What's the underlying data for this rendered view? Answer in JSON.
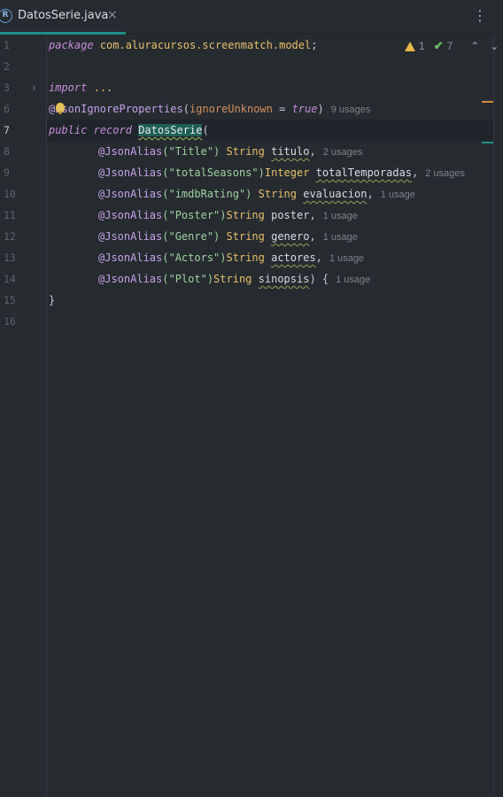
{
  "tab": {
    "icon_glyph": "R",
    "title": "DatosSerie.java",
    "close_glyph": "×"
  },
  "toolbar": {
    "more_glyph": "⋮"
  },
  "inspections": {
    "warnings": "1",
    "checks": "7",
    "check_glyph": "✔",
    "up_glyph": "⌃",
    "down_glyph": "⌄"
  },
  "lines": {
    "l1": {
      "num": "1",
      "kw": "package",
      "pkg": "com.aluracursos.screenmatch.model",
      "end": ";"
    },
    "l2": {
      "num": "2"
    },
    "l3": {
      "num": "3",
      "fold": "›",
      "kw": "import",
      "rest": "..."
    },
    "l6": {
      "num": "6",
      "ann": "@JsonIgnoreProperties",
      "open": "(",
      "param": "ignoreUnknown",
      "eq": " = ",
      "val": "true",
      "close": ")",
      "usages": "9 usages"
    },
    "l7": {
      "num": "7",
      "kw1": "public",
      "kw2": "record",
      "name": "DatosSerie",
      "open": "("
    },
    "l8": {
      "num": "8",
      "ann": "@JsonAlias",
      "arg": "(\"Title\")",
      "type": "String",
      "ident": "titulo",
      "end": ",",
      "usages": "2 usages"
    },
    "l9": {
      "num": "9",
      "ann": "@JsonAlias",
      "arg": "(\"totalSeasons\")",
      "type": "Integer",
      "ident": "totalTemporadas",
      "end": ",",
      "usages": "2 usages"
    },
    "l10": {
      "num": "10",
      "ann": "@JsonAlias",
      "arg": "(\"imdbRating\")",
      "type": "String",
      "ident": "evaluacion",
      "end": ",",
      "usages": "1 usage"
    },
    "l11": {
      "num": "11",
      "ann": "@JsonAlias",
      "arg": "(\"Poster\")",
      "type": "String",
      "ident": "poster",
      "end": ",",
      "usages": "1 usage"
    },
    "l12": {
      "num": "12",
      "ann": "@JsonAlias",
      "arg": "(\"Genre\")",
      "type": "String",
      "ident": "genero",
      "end": ",",
      "usages": "1 usage"
    },
    "l13": {
      "num": "13",
      "ann": "@JsonAlias",
      "arg": "(\"Actors\")",
      "type": "String",
      "ident": "actores",
      "end": ",",
      "usages": "1 usage"
    },
    "l14": {
      "num": "14",
      "ann": "@JsonAlias",
      "arg": "(\"Plot\")",
      "type": "String",
      "ident": "sinopsis",
      "end": ") {",
      "usages": "1 usage"
    },
    "l15": {
      "num": "15",
      "code": "}"
    },
    "l16": {
      "num": "16"
    }
  },
  "colors": {
    "background": "#262b30",
    "accent_tab": "#1f8f86",
    "keyword": "#c78bd8",
    "annotation": "#c4a2e8",
    "type": "#e8bf6a",
    "warning": "#e7b84b",
    "ok": "#6abf69"
  }
}
